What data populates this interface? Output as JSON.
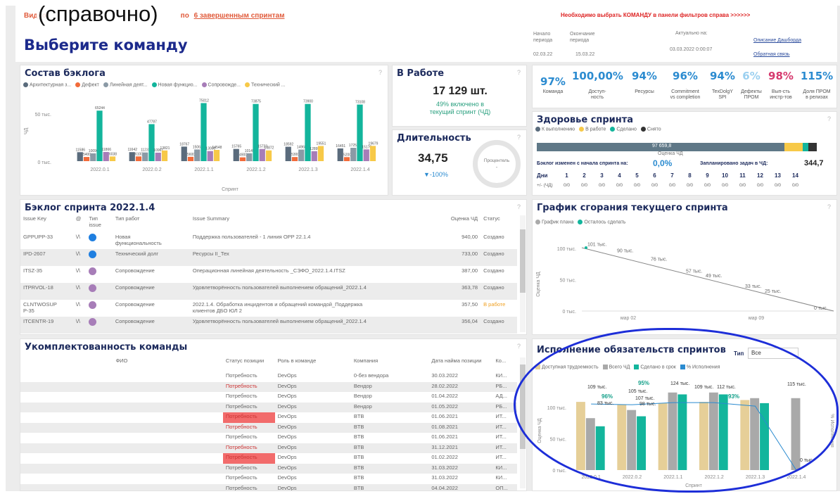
{
  "overlay_caption": "(справочно)",
  "banner": {
    "left": "Видно",
    "link": "6 завершенным спринтам",
    "left_tail": "по",
    "warning": "Необходимо выбрать КОМАНДУ в панели фильтров справа >>>>>>"
  },
  "header": {
    "title": "Выберите команду",
    "start_lbl": "Начало\nпериода",
    "end_lbl": "Окончание\nпериода",
    "start": "02.03.22",
    "end": "15.03.22",
    "actual_lbl": "Актуально на:",
    "actual": "03.03.2022 0:00:07",
    "link_desc": "Описание Дашборда",
    "link_fb": "Обратная связь"
  },
  "backlog_comp": {
    "title": "Состав бэклога",
    "legend": [
      {
        "label": "Архитектурная з...",
        "color": "#5a6b7c"
      },
      {
        "label": "Дефект",
        "color": "#f26b3a"
      },
      {
        "label": "Линейная деят...",
        "color": "#8b9aa6"
      },
      {
        "label": "Новая функцио...",
        "color": "#13b59c"
      },
      {
        "label": "Сопровожде...",
        "color": "#a77db8"
      },
      {
        "label": "Технический ...",
        "color": "#f7c948"
      }
    ],
    "ylabel": "ЧД",
    "xlabel": "Спринт",
    "yticks": [
      "50 тыс.",
      "0 тыс."
    ]
  },
  "in_work": {
    "title": "В Работе",
    "value": "17 129 шт.",
    "sub": "49% включено в\nтекущий спринт (ЧД)"
  },
  "duration": {
    "title": "Длительность",
    "value": "34,75",
    "delta": "▼-100%",
    "gauge_label": "Процентель",
    "gauge_sub": "-"
  },
  "kpis": [
    {
      "value": "97%",
      "label": "Команда"
    },
    {
      "value": "100,00%",
      "label": "Доступ-\nность"
    },
    {
      "value": "94%",
      "label": "Ресурсы"
    },
    {
      "value": "96%",
      "label": "Commitment\nvs completion"
    },
    {
      "value": "94%",
      "label": "TexDolgY\nSPI"
    },
    {
      "value": "6%",
      "label": "Дефекты\nПРОМ"
    },
    {
      "value": "98%",
      "label": "Вып-сть\nинстр-тов"
    },
    {
      "value": "115%",
      "label": "Доля ПРОМ\nв релизах"
    }
  ],
  "health": {
    "title": "Здоровье спринта",
    "legend": [
      {
        "label": "К выполнению",
        "color": "#5a6b7c"
      },
      {
        "label": "В работе",
        "color": "#f7c948"
      },
      {
        "label": "Сделано",
        "color": "#13b59c"
      },
      {
        "label": "Снято",
        "color": "#333"
      }
    ],
    "bar_value": "97 659,8",
    "bar_axis": "Оценка ЧД",
    "changed_lbl": "Бэклог изменен с начала спринта на:",
    "changed": "0,0%",
    "planned_lbl": "Запланировано задач в ЧД:",
    "planned": "344,7",
    "days_lbl": "Дни",
    "days": [
      "1",
      "2",
      "3",
      "4",
      "5",
      "6",
      "7",
      "8",
      "9",
      "10",
      "11",
      "12",
      "13",
      "14"
    ],
    "row_lbl": "+/- (ЧД)",
    "row_vals": [
      "0/0",
      "0/0",
      "0/0",
      "0/0",
      "0/0",
      "0/0",
      "0/0",
      "0/0",
      "0/0",
      "0/0",
      "0/0",
      "0/0",
      "0/0",
      "0/0"
    ]
  },
  "sprint_backlog": {
    "title": "Бэклог спринта 2022.1.4",
    "headers": [
      "Issue Key",
      "@",
      "Тип issue",
      "Тип работ",
      "Issue Summary",
      "Оценка ЧД",
      "Статус"
    ],
    "rows": [
      {
        "key": "GPPUPP-33",
        "at": "\\/\\",
        "color": "#1f7fe0",
        "type": "Новая\nфункциональность",
        "summary": "Поддержка пользователей - 1 линия OPP 22.1.4",
        "est": "940,00",
        "status": "Создано",
        "orange": false
      },
      {
        "key": "IPD-2607",
        "at": "\\/\\",
        "color": "#1f7fe0",
        "type": "Технический долг",
        "summary": "Ресурсы II_Тех",
        "est": "733,00",
        "status": "Создано",
        "orange": false
      },
      {
        "key": "ITSZ-35",
        "at": "\\/\\",
        "color": "#a77db8",
        "type": "Сопровождение",
        "summary": "Операционная линейная деятельность _СЭФО_2022.1.4.ITSZ",
        "est": "387,00",
        "status": "Создано",
        "orange": false
      },
      {
        "key": "ITPRVOL-18",
        "at": "\\/\\",
        "color": "#a77db8",
        "type": "Сопровождение",
        "summary": "Удовлетворённость пользователей выполнением обращений_2022.1.4",
        "est": "363,78",
        "status": "Создано",
        "orange": false
      },
      {
        "key": "CLNTWOSUP\nP-35",
        "at": "\\/\\",
        "color": "#a77db8",
        "type": "Сопровождение",
        "summary": "2022.1.4. Обработка инцидентов и обращений командой_Поддержка\nклиентов ДБО ЮЛ 2",
        "est": "357,50",
        "status": "В работе",
        "orange": true
      },
      {
        "key": "ITCENTR-19",
        "at": "\\/\\",
        "color": "#a77db8",
        "type": "Сопровождение",
        "summary": "Удовлетворённость пользователей выполнением обращений_2022.1.4",
        "est": "356,04",
        "status": "Создано",
        "orange": false
      }
    ]
  },
  "burndown": {
    "title": "График сгорания текущего спринта",
    "legend": [
      {
        "label": "График плана",
        "color": "#aaa"
      },
      {
        "label": "Осталось сделать",
        "color": "#13b59c"
      }
    ],
    "ylabel": "Оценка ЧД",
    "yticks": [
      "100 тыс.",
      "50 тыс.",
      "0 тыс."
    ],
    "xticks": [
      "мар 02",
      "мар 09"
    ],
    "labels": [
      "101 тыс.",
      "90 тыс.",
      "76 тыс.",
      "57 тыс.",
      "49 тыс.",
      "33 тыс.",
      "25 тыс.",
      "0 тыс."
    ]
  },
  "staffing": {
    "title": "Укомплектованность команды",
    "headers": [
      "ФИО",
      "Статус позиции",
      "Роль в команде",
      "Компания",
      "Дата найма позиции",
      "Ко..."
    ],
    "rows": [
      {
        "status": "Потребность",
        "role": "DevOps",
        "company": "0-без вендора",
        "date": "30.03.2022",
        "ko": "КИ...",
        "red": false
      },
      {
        "status": "Потребность",
        "role": "DevOps",
        "company": "Вендор",
        "date": "28.02.2022",
        "ko": "РБ...",
        "red": true
      },
      {
        "status": "Потребность",
        "role": "DevOps",
        "company": "Вендор",
        "date": "01.04.2022",
        "ko": "АД...",
        "red": false
      },
      {
        "status": "Потребность",
        "role": "DevOps",
        "company": "Вендор",
        "date": "01.05.2022",
        "ko": "РБ...",
        "red": false
      },
      {
        "status": "Потребность",
        "role": "DevOps",
        "company": "BTB",
        "date": "01.06.2021",
        "ko": "ИТ...",
        "red": true
      },
      {
        "status": "Потребность",
        "role": "DevOps",
        "company": "BTB",
        "date": "01.08.2021",
        "ko": "ИТ...",
        "red": true
      },
      {
        "status": "Потребность",
        "role": "DevOps",
        "company": "BTB",
        "date": "01.06.2021",
        "ko": "ИТ...",
        "red": false
      },
      {
        "status": "Потребность",
        "role": "DevOps",
        "company": "BTB",
        "date": "31.12.2021",
        "ko": "ИТ...",
        "red": true
      },
      {
        "status": "Потребность",
        "role": "DevOps",
        "company": "BTB",
        "date": "01.02.2022",
        "ko": "ИТ...",
        "red": true
      },
      {
        "status": "Потребность",
        "role": "DevOps",
        "company": "BTB",
        "date": "31.03.2022",
        "ko": "КИ...",
        "red": false
      },
      {
        "status": "Потребность",
        "role": "DevOps",
        "company": "BTB",
        "date": "31.03.2022",
        "ko": "КИ...",
        "red": false
      },
      {
        "status": "Потребность",
        "role": "DevOps",
        "company": "BTB",
        "date": "04.04.2022",
        "ko": "ОП...",
        "red": false
      }
    ]
  },
  "commitment": {
    "title": "Исполнение обязательств спринтов",
    "filter_lbl": "Тип",
    "filter_val": "Все",
    "legend": [
      {
        "label": "Доступная трудоемкость",
        "color": "#e6cf98"
      },
      {
        "label": "Всего ЧД",
        "color": "#a9a9a9"
      },
      {
        "label": "Сделано в срок",
        "color": "#13b59c"
      },
      {
        "label": "% Исполнения",
        "color": "#2b8bd0"
      }
    ],
    "ylabel": "Оценка ЧД",
    "ylabel2": "% Исполнения",
    "xlabel": "Спринт",
    "yticks": [
      "100 тыс.",
      "50 тыс.",
      "0 тыс."
    ],
    "labels": [
      "109 тыс.",
      "96%",
      "83 тыс.",
      "105 тыс.",
      "95%",
      "107 тыс.",
      "98 тыс.",
      "124 тыс.",
      "109 тыс.",
      "112 тыс.",
      "93%",
      "115 тыс.",
      "0 тыс."
    ]
  },
  "chart_data": [
    {
      "type": "bar",
      "title": "Состав бэклога",
      "xlabel": "Спринт",
      "ylabel": "ЧД",
      "categories": [
        "2022.0.1",
        "2022.0.2",
        "2022.1.1",
        "2022.1.2",
        "2022.1.3",
        "2022.1.4"
      ],
      "series": [
        {
          "name": "Архитектурная з...",
          "values": [
            11586,
            11642,
            18767,
            15765,
            18592,
            16451
          ]
        },
        {
          "name": "Дефект",
          "values": [
            5400,
            6100,
            5600,
            4900,
            5300,
            5200
          ]
        },
        {
          "name": "Линейная деят...",
          "values": [
            10096,
            11231,
            15062,
            10145,
            14968,
            17251
          ]
        },
        {
          "name": "Новая функцио...",
          "values": [
            65244,
            47787,
            75012,
            73875,
            73900,
            73108
          ]
        },
        {
          "name": "Сопровожде...",
          "values": [
            11866,
            10961,
            13006,
            15723,
            12895,
            15170
          ]
        },
        {
          "name": "Технический ...",
          "values": [
            6038,
            13821,
            14548,
            13872,
            19551,
            19679
          ]
        }
      ]
    },
    {
      "type": "line",
      "title": "График сгорания текущего спринта",
      "ylabel": "Оценка ЧД",
      "x": [
        "мар 02",
        "мар 09"
      ],
      "series": [
        {
          "name": "График плана",
          "values": [
            101000,
            0
          ]
        },
        {
          "name": "Осталось сделать",
          "values": [
            101000,
            101000
          ]
        }
      ],
      "ylim": [
        0,
        110000
      ]
    },
    {
      "type": "bar",
      "title": "Исполнение обязательств спринтов",
      "xlabel": "Спринт",
      "ylabel": "Оценка ЧД",
      "categories": [
        "2022.0.1",
        "2022.0.2",
        "2022.1.1",
        "2022.1.2",
        "2022.1.3",
        "2022.1.4"
      ],
      "series": [
        {
          "name": "Доступная трудоемкость",
          "values": [
            109000,
            105000,
            107000,
            109000,
            112000,
            0
          ]
        },
        {
          "name": "Всего ЧД",
          "values": [
            83000,
            96000,
            124000,
            124000,
            115000,
            115000
          ]
        },
        {
          "name": "Сделано в срок",
          "values": [
            70000,
            86000,
            121000,
            121000,
            107000,
            0
          ]
        },
        {
          "name": "% Исполнения",
          "values": [
            96,
            95,
            98,
            98,
            93,
            0
          ]
        }
      ]
    }
  ]
}
